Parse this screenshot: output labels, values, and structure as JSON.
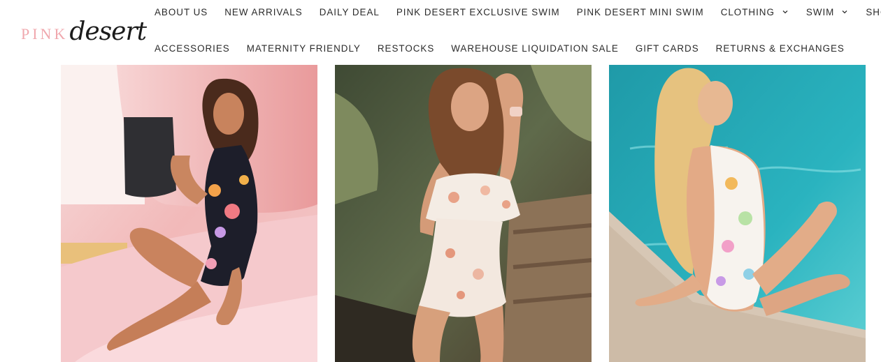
{
  "brand": {
    "logo_pink": "PINK",
    "logo_desert": "desert"
  },
  "nav": {
    "row1": [
      {
        "label": "ABOUT US"
      },
      {
        "label": "NEW ARRIVALS"
      },
      {
        "label": "DAILY DEAL"
      },
      {
        "label": "PINK DESERT EXCLUSIVE SWIM"
      },
      {
        "label": "PINK DESERT MINI SWIM"
      },
      {
        "label": "CLOTHING",
        "dropdown": true
      },
      {
        "label": "SWIM",
        "dropdown": true
      },
      {
        "label": "SHOES"
      }
    ],
    "row2": [
      {
        "label": "ACCESSORIES"
      },
      {
        "label": "MATERNITY FRIENDLY"
      },
      {
        "label": "RESTOCKS"
      },
      {
        "label": "WAREHOUSE LIQUIDATION SALE"
      },
      {
        "label": "GIFT CARDS"
      },
      {
        "label": "RETURNS & EXCHANGES"
      }
    ]
  },
  "colors": {
    "brand_pink": "#f0a8ae",
    "text_dark": "#2a2a2a",
    "pool_blue": "#2aa9b5"
  }
}
